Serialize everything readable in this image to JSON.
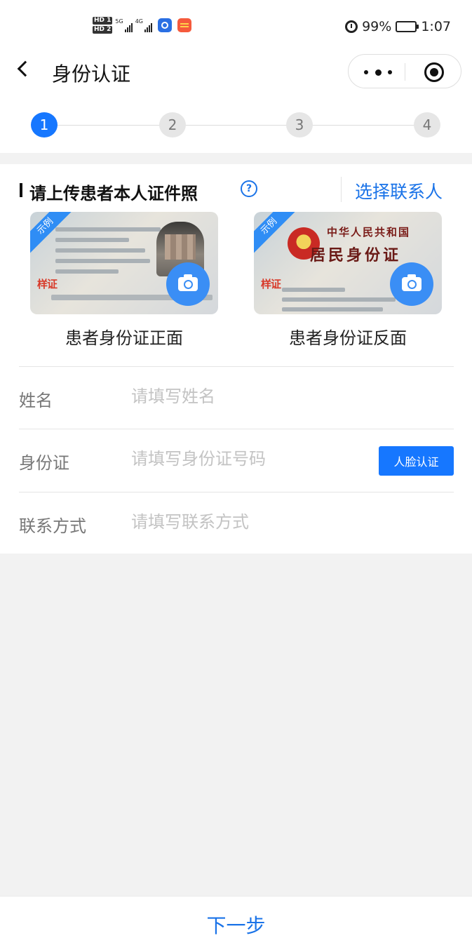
{
  "status_bar": {
    "hd1": "HD 1",
    "hd2": "HD 2",
    "net1": "5G",
    "net2": "4G",
    "battery": "99%",
    "time": "1:07"
  },
  "nav": {
    "title": "身份认证"
  },
  "steps": [
    "1",
    "2",
    "3",
    "4"
  ],
  "current_step": 1,
  "section": {
    "title": "请上传患者本人证件照",
    "help": "?",
    "select_contact": "选择联系人"
  },
  "id_cards": {
    "sample_tag": "示例",
    "watermark": "样证",
    "back_line1": "中华人民共和国",
    "back_line2": "居民身份证",
    "front_label": "患者身份证正面",
    "back_label": "患者身份证反面"
  },
  "form": {
    "name_label": "姓名",
    "name_placeholder": "请填写姓名",
    "id_label": "身份证",
    "id_placeholder": "请填写身份证号码",
    "face_auth": "人脸认证",
    "contact_label": "联系方式",
    "contact_placeholder": "请填写联系方式"
  },
  "footer": {
    "next": "下一步"
  },
  "colors": {
    "primary": "#1677ff",
    "link": "#1a73e8",
    "background": "#f2f2f2"
  }
}
